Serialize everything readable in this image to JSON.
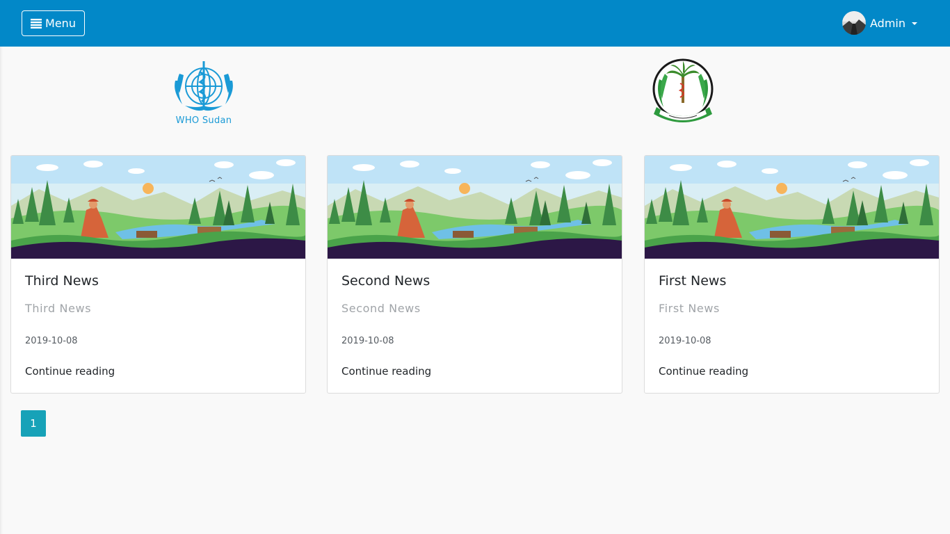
{
  "navbar": {
    "menu_label": "Menu",
    "menu_icon": "bars-icon",
    "user_label": "Admin",
    "accent": "#0288c8"
  },
  "logos": {
    "who_text": "WHO Sudan"
  },
  "news": [
    {
      "title": "Third News",
      "subtitle": "Third News",
      "date": "2019-10-08",
      "link": "Continue reading"
    },
    {
      "title": "Second News",
      "subtitle": "Second News",
      "date": "2019-10-08",
      "link": "Continue reading"
    },
    {
      "title": "First News",
      "subtitle": "First News",
      "date": "2019-10-08",
      "link": "Continue reading"
    }
  ],
  "pagination": {
    "current": "1",
    "color": "#17a2b8"
  }
}
